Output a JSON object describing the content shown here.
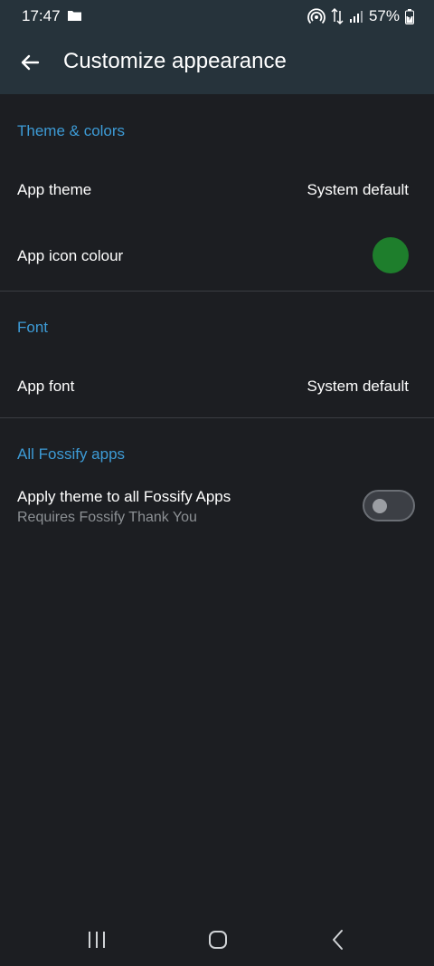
{
  "status_bar": {
    "time": "17:47",
    "battery": "57%",
    "icons": [
      "folder-icon",
      "hotspot-icon",
      "data-arrows-icon",
      "signal-icon",
      "battery-icon"
    ]
  },
  "app_bar": {
    "title": "Customize appearance",
    "back_icon": "arrow-left-icon"
  },
  "sections": {
    "theme": {
      "header": "Theme & colors",
      "app_theme_label": "App theme",
      "app_theme_value": "System default",
      "app_icon_colour_label": "App icon colour",
      "app_icon_colour": "#1e7e2c"
    },
    "font": {
      "header": "Font",
      "app_font_label": "App font",
      "app_font_value": "System default"
    },
    "all_apps": {
      "header": "All Fossify apps",
      "apply_label": "Apply theme to all Fossify Apps",
      "apply_sub": "Requires Fossify Thank You",
      "apply_enabled": false
    }
  },
  "nav_bar": {
    "icons": [
      "recents-icon",
      "home-icon",
      "back-icon"
    ]
  },
  "colors": {
    "accent": "#3d9bd6",
    "background": "#1c1e22",
    "toolbar": "#26333b"
  }
}
